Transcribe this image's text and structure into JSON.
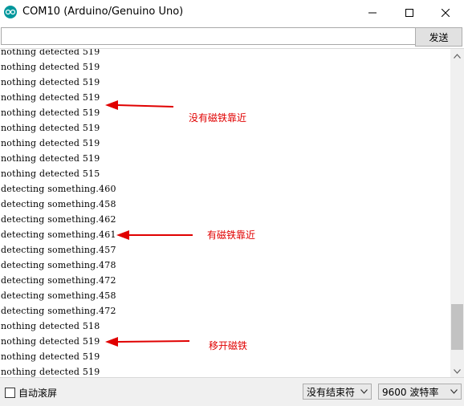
{
  "window": {
    "title": "COM10 (Arduino/Genuino Uno)",
    "app_icon": "arduino-logo-icon",
    "controls": [
      "minimize-icon",
      "maximize-icon",
      "close-icon"
    ]
  },
  "send": {
    "input_value": "",
    "button_label": "发送"
  },
  "monitor": {
    "lines": [
      "nothing detected 519",
      "nothing detected 519",
      "nothing detected 519",
      "nothing detected 519",
      "nothing detected 519",
      "nothing detected 519",
      "nothing detected 519",
      "nothing detected 519",
      "nothing detected 515",
      "detecting something.460",
      "detecting something.458",
      "detecting something.462",
      "detecting something.461",
      "detecting something.457",
      "detecting something.478",
      "detecting something.472",
      "detecting something.458",
      "detecting something.472",
      "nothing detected 518",
      "nothing detected 519",
      "nothing detected 519",
      "nothing detected 519",
      "nothing detected 519"
    ]
  },
  "annotations": [
    {
      "label": "没有磁铁靠近",
      "color": "#e00000"
    },
    {
      "label": "有磁铁靠近",
      "color": "#e00000"
    },
    {
      "label": "移开磁铁",
      "color": "#e00000"
    }
  ],
  "footer": {
    "autoscroll_label": "自动滚屏",
    "autoscroll_checked": false,
    "line_ending": "没有结束符",
    "baud_rate": "9600 波特率"
  }
}
